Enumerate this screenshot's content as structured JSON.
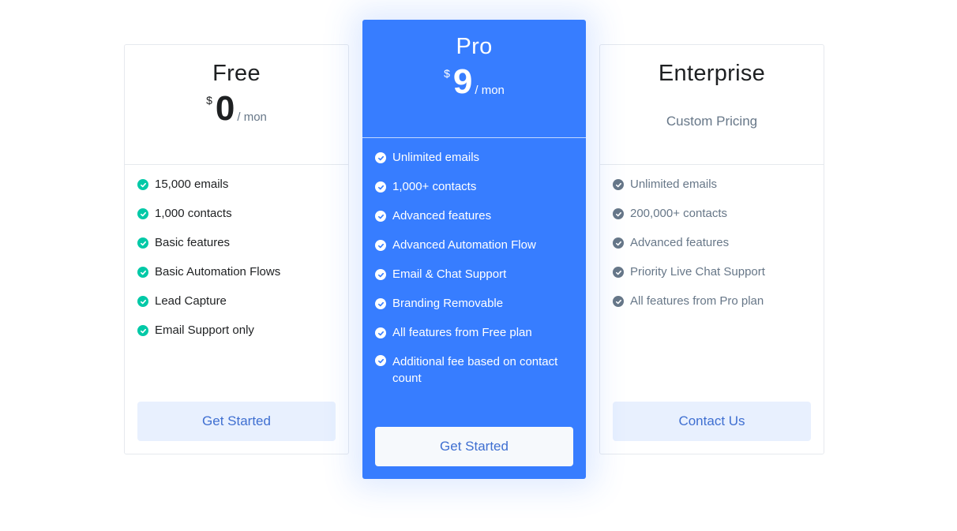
{
  "colors": {
    "accent": "#377dff",
    "free_check": "#00c9a7",
    "enterprise_check": "#677788",
    "button_text": "#3f6fd1"
  },
  "plans": [
    {
      "name": "Free",
      "currency": "$",
      "amount": "0",
      "period": "/ mon",
      "features": [
        "15,000 emails",
        "1,000 contacts",
        "Basic features",
        "Basic Automation Flows",
        "Lead Capture",
        "Email Support only"
      ],
      "cta": "Get Started"
    },
    {
      "name": "Pro",
      "currency": "$",
      "amount": "9",
      "period": "/ mon",
      "highlighted": true,
      "features": [
        "Unlimited emails",
        "1,000+ contacts",
        "Advanced features",
        "Advanced Automation Flow",
        "Email & Chat Support",
        "Branding Removable",
        "All features from Free plan",
        "Additional fee based on contact count"
      ],
      "cta": "Get Started"
    },
    {
      "name": "Enterprise",
      "price_label": "Custom Pricing",
      "features": [
        "Unlimited emails",
        "200,000+ contacts",
        "Advanced features",
        "Priority Live Chat Support",
        "All features from Pro plan"
      ],
      "cta": "Contact Us"
    }
  ],
  "icons": {
    "feature_check": "check-circle-icon"
  }
}
